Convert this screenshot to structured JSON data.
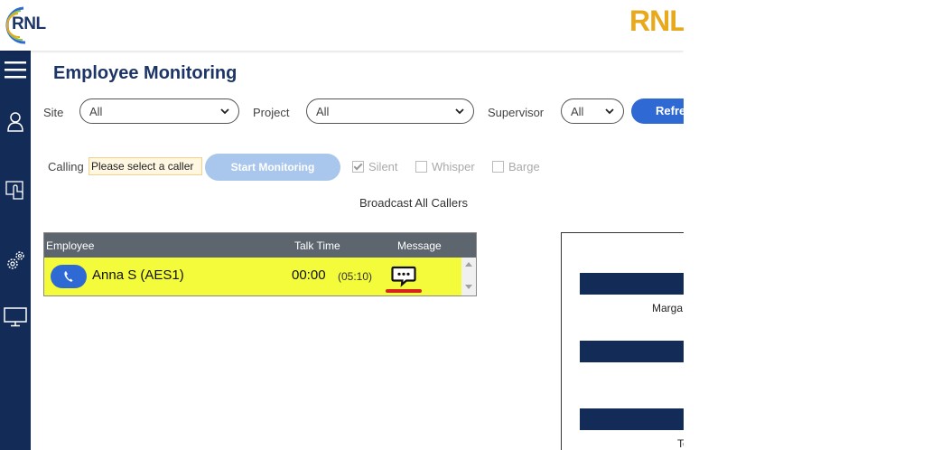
{
  "header": {
    "logo_left_text": "RNL",
    "logo_right_text": "RNL"
  },
  "sidebar": {
    "icons": [
      "hamburger-menu-icon",
      "user-icon",
      "hand-pointer-icon",
      "settings-gears-icon",
      "monitor-icon"
    ]
  },
  "page": {
    "title": "Employee Monitoring"
  },
  "filters": {
    "site_label": "Site",
    "site_value": "All",
    "project_label": "Project",
    "project_value": "All",
    "supervisor_label": "Supervisor",
    "supervisor_value": "All",
    "refresh_label": "Refresh"
  },
  "calling": {
    "label": "Calling",
    "caller_value": "Please select a caller",
    "start_button": "Start Monitoring",
    "options": [
      {
        "label": "Silent",
        "checked": true
      },
      {
        "label": "Whisper",
        "checked": false
      },
      {
        "label": "Barge",
        "checked": false
      }
    ],
    "broadcast_label": "Broadcast All Callers"
  },
  "table": {
    "columns": [
      "Employee",
      "Talk Time",
      "Message"
    ],
    "rows": [
      {
        "employee": "Anna S (AES1)",
        "talk_time": "00:00",
        "total_time": "(05:10)",
        "message_icon": "chat-bubble-icon"
      }
    ]
  },
  "side_panel": {
    "captions": [
      "Marga",
      "",
      "Te"
    ]
  },
  "colors": {
    "brand_navy": "#132b57",
    "accent_blue": "#2f6ad4",
    "row_highlight": "#f3fb3a",
    "logo_gold": "#e8a91c"
  }
}
